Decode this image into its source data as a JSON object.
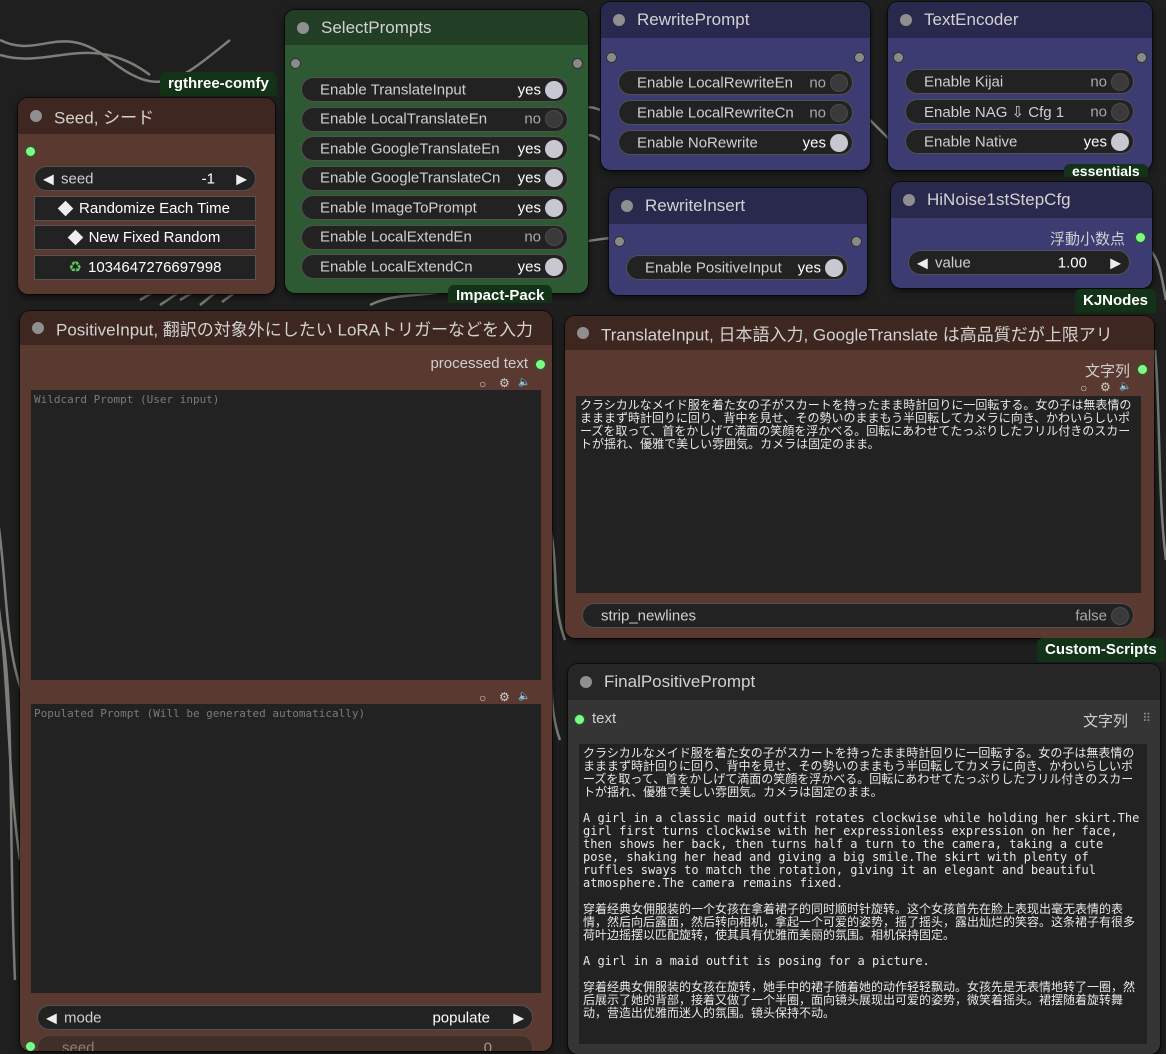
{
  "seed_node": {
    "title": "Seed, シード",
    "seed_label": "seed",
    "seed_value": "-1",
    "randomize_label": "Randomize Each Time",
    "new_fixed_label": "New Fixed Random",
    "last_seed": "1034647276697998",
    "badge": "rgthree-comfy"
  },
  "select_prompts": {
    "title": "SelectPrompts",
    "toggles": [
      {
        "label": "Enable TranslateInput",
        "value": "yes"
      },
      {
        "label": "Enable LocalTranslateEn",
        "value": "no"
      },
      {
        "label": "Enable GoogleTranslateEn",
        "value": "yes"
      },
      {
        "label": "Enable GoogleTranslateCn",
        "value": "yes"
      },
      {
        "label": "Enable ImageToPrompt",
        "value": "yes"
      },
      {
        "label": "Enable LocalExtendEn",
        "value": "no"
      },
      {
        "label": "Enable LocalExtendCn",
        "value": "yes"
      }
    ],
    "badge": "Impact-Pack"
  },
  "rewrite_prompt": {
    "title": "RewritePrompt",
    "toggles": [
      {
        "label": "Enable LocalRewriteEn",
        "value": "no"
      },
      {
        "label": "Enable LocalRewriteCn",
        "value": "no"
      },
      {
        "label": "Enable NoRewrite",
        "value": "yes"
      }
    ]
  },
  "text_encoder": {
    "title": "TextEncoder",
    "toggles": [
      {
        "label": "Enable Kijai",
        "value": "no"
      },
      {
        "label": "Enable NAG ⇩ Cfg 1",
        "value": "no"
      },
      {
        "label": "Enable Native",
        "value": "yes"
      }
    ],
    "badge": "essentials"
  },
  "rewrite_insert": {
    "title": "RewriteInsert",
    "toggles": [
      {
        "label": "Enable PositiveInput",
        "value": "yes"
      }
    ]
  },
  "hinoise": {
    "title": "HiNoise1stStepCfg",
    "output_label": "浮動小数点",
    "value_label": "value",
    "value": "1.00",
    "badge": "KJNodes"
  },
  "positive_input": {
    "title": "PositiveInput, 翻訳の対象外にしたい LoRAトリガーなどを入力",
    "output_label": "processed text",
    "wildcard_placeholder": "Wildcard Prompt (User input)",
    "populated_placeholder": "Populated Prompt (Will be generated automatically)",
    "mode_label": "mode",
    "mode_value": "populate",
    "seed_label": "seed",
    "seed_value": "0"
  },
  "translate_input": {
    "title": "TranslateInput, 日本語入力, GoogleTranslate は高品質だが上限アリ",
    "output_label": "文字列",
    "text": "クラシカルなメイド服を着た女の子がスカートを持ったまま時計回りに一回転する。女の子は無表情のまままず時計回りに回り、背中を見せ、その勢いのままもう半回転してカメラに向き、かわいらしいポーズを取って、首をかしげて満面の笑顔を浮かべる。回転にあわせてたっぷりしたフリル付きのスカートが揺れ、優雅で美しい雰囲気。カメラは固定のまま。",
    "strip_label": "strip_newlines",
    "strip_value": "false",
    "badge": "Custom-Scripts"
  },
  "final_prompt": {
    "title": "FinalPositivePrompt",
    "input_label": "text",
    "output_label": "文字列",
    "paragraphs": [
      "クラシカルなメイド服を着た女の子がスカートを持ったまま時計回りに一回転する。女の子は無表情のまままず時計回りに回り、背中を見せ、その勢いのままもう半回転してカメラに向き、かわいらしいポーズを取って、首をかしげて満面の笑顔を浮かべる。回転にあわせてたっぷりしたフリル付きのスカートが揺れ、優雅で美しい雰囲気。カメラは固定のまま。",
      "A girl in a classic maid outfit rotates clockwise while holding her skirt.The girl first turns clockwise with her expressionless expression on her face, then shows her back, then turns half a turn to the camera, taking a cute pose, shaking her head and giving a big smile.The skirt with plenty of ruffles sways to match the rotation, giving it an elegant and beautiful atmosphere.The camera remains fixed.",
      "穿着经典女佣服装的一个女孩在拿着裙子的同时顺时针旋转。这个女孩首先在脸上表现出毫无表情的表情，然后向后露面，然后转向相机，拿起一个可爱的姿势，摇了摇头，露出灿烂的笑容。这条裙子有很多荷叶边摇摆以匹配旋转，使其具有优雅而美丽的氛围。相机保持固定。",
      "A girl in a maid outfit is posing for a picture.",
      "穿着经典女佣服装的女孩在旋转，她手中的裙子随着她的动作轻轻飘动。女孩先是无表情地转了一圈，然后展示了她的背部，接着又做了一个半圈，面向镜头展现出可爱的姿势，微笑着摇头。裙摆随着旋转舞动，营造出优雅而迷人的氛围。镜头保持不动。"
    ]
  },
  "colors": {
    "canvas": "#1e1f1e",
    "node_brown": "#593930",
    "node_green": "#2d5a32",
    "node_purple": "#3c3c73",
    "node_gray": "#353535",
    "socket_green": "#7cfc84"
  },
  "icons": [
    "dice-icon",
    "recycle-icon",
    "circle-icon",
    "gear-icon",
    "speaker-icon",
    "grid-icon"
  ]
}
